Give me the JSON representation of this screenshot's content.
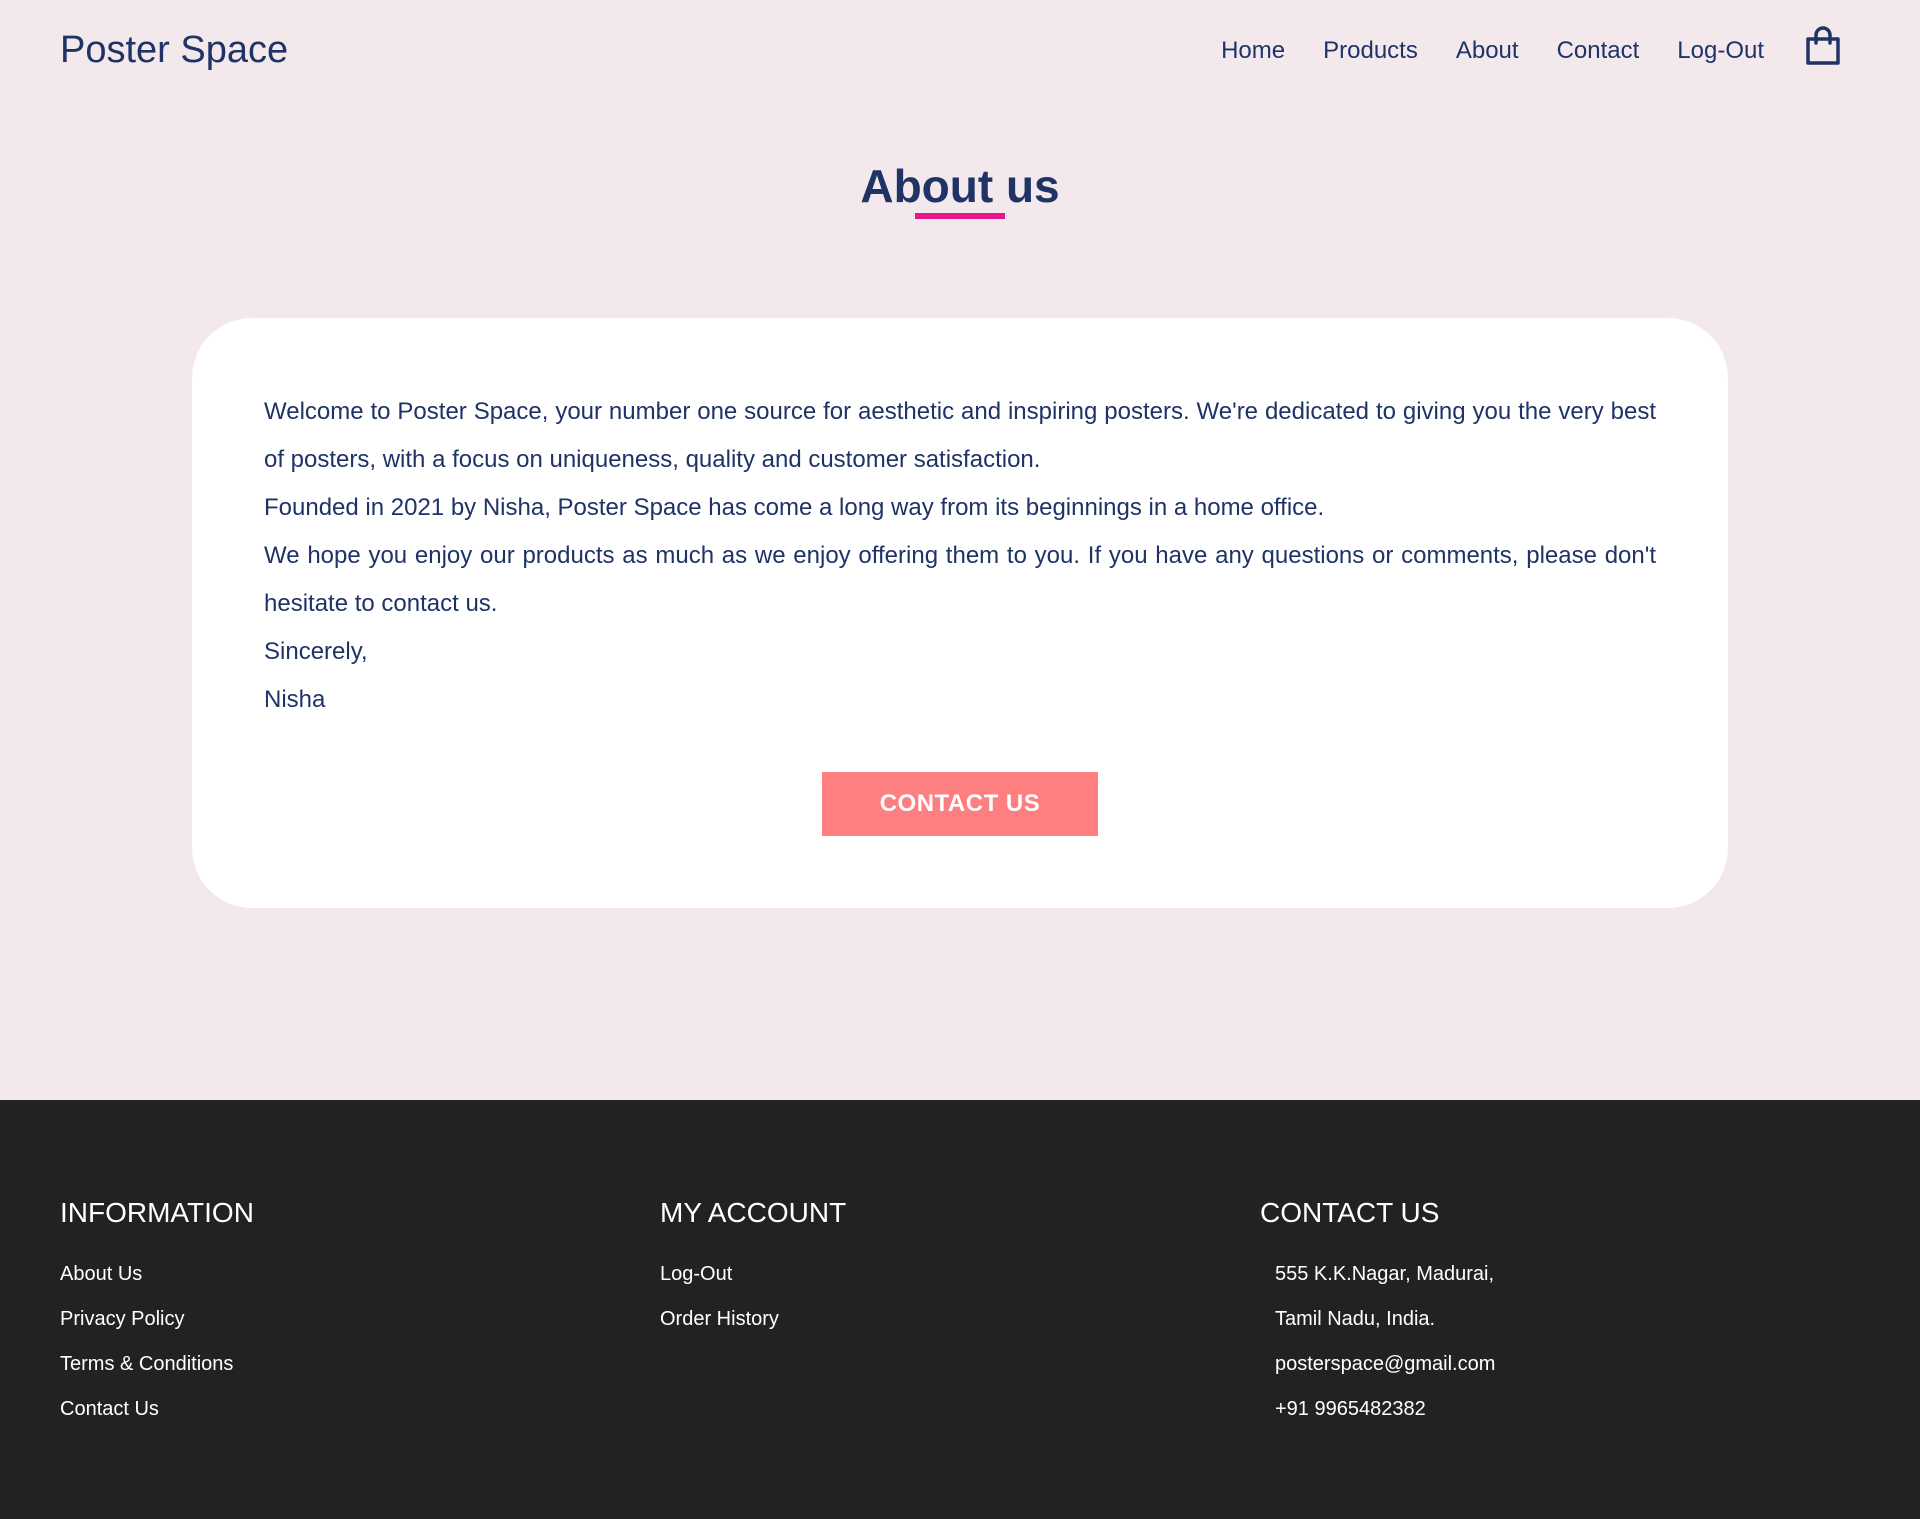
{
  "header": {
    "brand": "Poster Space",
    "nav": [
      {
        "label": "Home"
      },
      {
        "label": "Products"
      },
      {
        "label": "About"
      },
      {
        "label": "Contact"
      },
      {
        "label": "Log-Out"
      }
    ],
    "cart_icon": "shopping-bag-icon"
  },
  "colors": {
    "background": "#f3e9ed",
    "text_primary": "#1f3366",
    "accent_underline": "#e6178a",
    "button": "#fd7f7f",
    "footer_bg": "#222222"
  },
  "main": {
    "title": "About us",
    "paragraphs": [
      "Welcome to Poster Space, your number one source for aesthetic and inspiring posters. We're dedicated to giving you the very best of posters, with a focus on uniqueness, quality and customer satisfaction.",
      "Founded in 2021 by Nisha, Poster Space has come a long way from its beginnings in a home office.",
      "We hope you enjoy our products as much as we enjoy offering them to you. If you have any questions or comments, please don't hesitate to contact us.",
      "Sincerely,",
      "Nisha"
    ],
    "contact_button": "CONTACT US"
  },
  "footer": {
    "information": {
      "heading": "INFORMATION",
      "items": [
        "About Us",
        "Privacy Policy",
        "Terms & Conditions",
        "Contact Us"
      ]
    },
    "account": {
      "heading": "MY ACCOUNT",
      "items": [
        "Log-Out",
        "Order History"
      ]
    },
    "contact": {
      "heading": "CONTACT US",
      "items": [
        "555 K.K.Nagar, Madurai,",
        "Tamil Nadu, India.",
        "posterspace@gmail.com",
        "+91 9965482382"
      ]
    }
  }
}
